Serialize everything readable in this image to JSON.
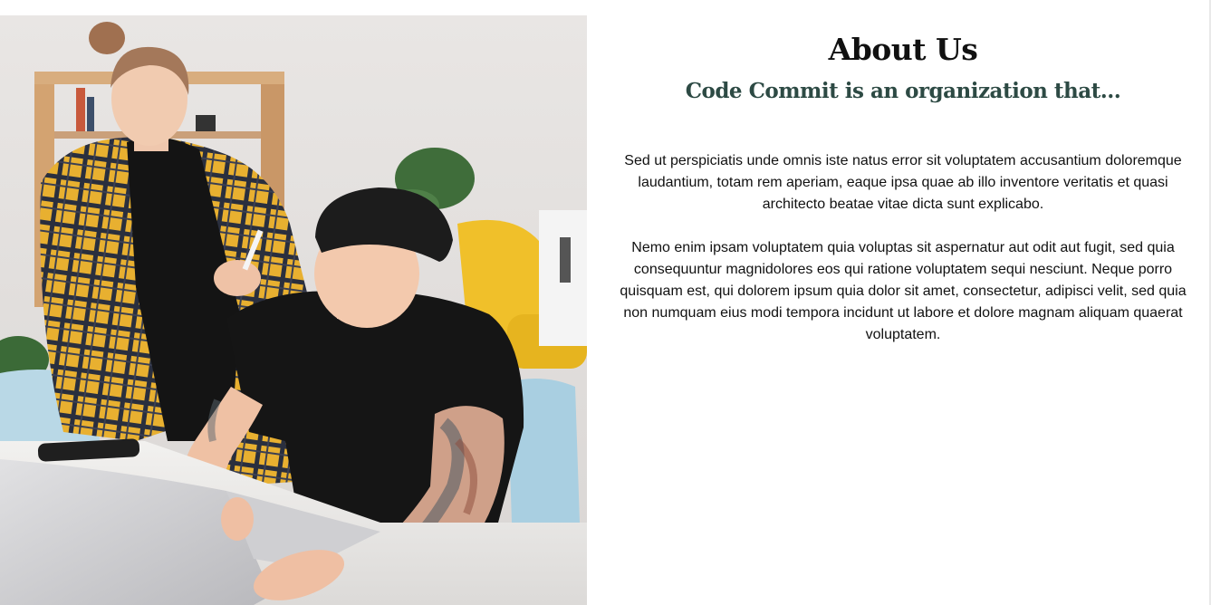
{
  "about": {
    "title": "About Us",
    "subtitle": "Code Commit is an organization that...",
    "paragraphs": [
      "Sed ut perspiciatis unde omnis iste natus error sit voluptatem accusantium doloremque laudantium, totam rem aperiam, eaque ipsa quae ab illo inventore veritatis et quasi architecto beatae vitae dicta sunt explicabo.",
      "Nemo enim ipsam voluptatem quia voluptas sit aspernatur aut odit aut fugit, sed quia consequuntur magnidolores eos qui ratione voluptatem sequi nesciunt. Neque porro quisquam est, qui dolorem ipsum quia dolor sit amet, consectetur, adipisci velit, sed quia non numquam eius modi tempora incidunt ut labore et dolore magnam aliquam quaerat voluptatem."
    ]
  },
  "colors": {
    "title": "#111111",
    "subtitle": "#2d4a44",
    "body_text": "#111111",
    "background": "#ffffff"
  }
}
